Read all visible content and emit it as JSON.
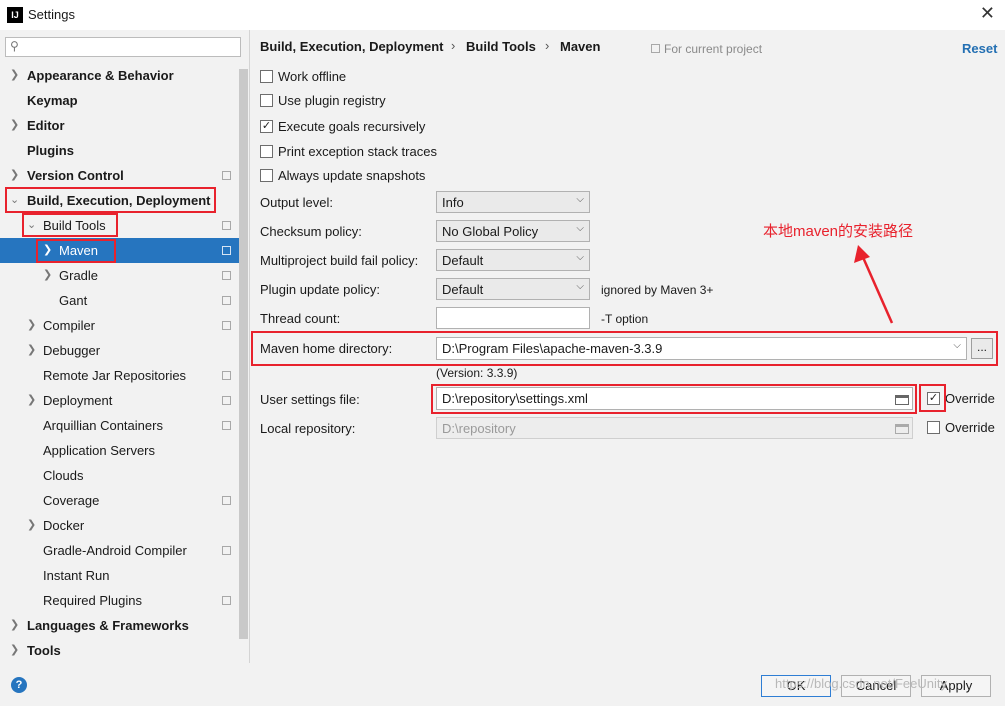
{
  "window": {
    "title": "Settings",
    "app_icon": "IJ"
  },
  "search": {
    "placeholder": ""
  },
  "sidebar": {
    "items": [
      {
        "label": "Appearance & Behavior"
      },
      {
        "label": "Keymap"
      },
      {
        "label": "Editor"
      },
      {
        "label": "Plugins"
      },
      {
        "label": "Version Control"
      },
      {
        "label": "Build, Execution, Deployment"
      },
      {
        "label": "Build Tools"
      },
      {
        "label": "Maven"
      },
      {
        "label": "Gradle"
      },
      {
        "label": "Gant"
      },
      {
        "label": "Compiler"
      },
      {
        "label": "Debugger"
      },
      {
        "label": "Remote Jar Repositories"
      },
      {
        "label": "Deployment"
      },
      {
        "label": "Arquillian Containers"
      },
      {
        "label": "Application Servers"
      },
      {
        "label": "Clouds"
      },
      {
        "label": "Coverage"
      },
      {
        "label": "Docker"
      },
      {
        "label": "Gradle-Android Compiler"
      },
      {
        "label": "Instant Run"
      },
      {
        "label": "Required Plugins"
      },
      {
        "label": "Languages & Frameworks"
      },
      {
        "label": "Tools"
      }
    ]
  },
  "breadcrumb": [
    "Build, Execution, Deployment",
    "Build Tools",
    "Maven"
  ],
  "for_current_project": "For current project",
  "reset_label": "Reset",
  "checkboxes": [
    {
      "label": "Work offline",
      "checked": false
    },
    {
      "label": "Use plugin registry",
      "checked": false
    },
    {
      "label": "Execute goals recursively",
      "checked": true
    },
    {
      "label": "Print exception stack traces",
      "checked": false
    },
    {
      "label": "Always update snapshots",
      "checked": false
    }
  ],
  "fields": {
    "output_level": {
      "label": "Output level:",
      "value": "Info"
    },
    "checksum_policy": {
      "label": "Checksum policy:",
      "value": "No Global Policy"
    },
    "multiproject_fail_policy": {
      "label": "Multiproject build fail policy:",
      "value": "Default"
    },
    "plugin_update_policy": {
      "label": "Plugin update policy:",
      "value": "Default",
      "note": "ignored by Maven 3+"
    },
    "thread_count": {
      "label": "Thread count:",
      "value": "",
      "note": "-T option"
    },
    "maven_home": {
      "label": "Maven home directory:",
      "value": "D:\\Program Files\\apache-maven-3.3.9",
      "version": "(Version: 3.3.9)",
      "browse_label": "..."
    },
    "user_settings": {
      "label": "User settings file:",
      "value": "D:\\repository\\settings.xml",
      "override_label": "Override",
      "override_checked": true
    },
    "local_repository": {
      "label": "Local repository:",
      "value": "D:\\repository",
      "override_label": "Override",
      "override_checked": false
    }
  },
  "annotation": "本地maven的安装路径",
  "footer": {
    "help_label": "?",
    "ok_label": "OK",
    "cancel_label": "Cancel",
    "apply_label": "Apply"
  },
  "watermark": "https://blog.csdn.net/FeeUnity",
  "colors": {
    "selection": "#2675bf",
    "highlight_box": "#e8222d",
    "link": "#2470b3"
  }
}
